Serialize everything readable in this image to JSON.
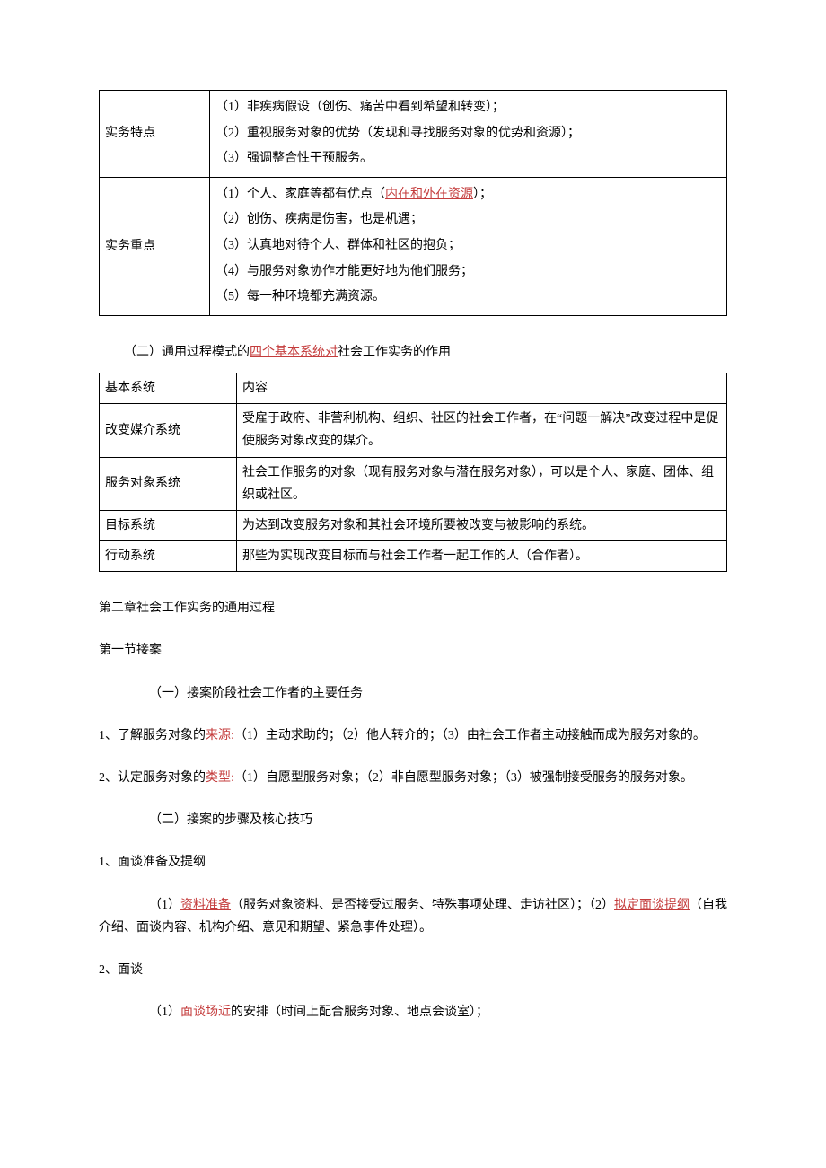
{
  "table1": {
    "row1": {
      "label": "实务特点",
      "lines": [
        "（1）非疾病假设（创伤、痛苦中看到希望和转变）；",
        "（2）重视服务对象的优势（发现和寻找服务对象的优势和资源）；",
        "（3）强调整合性干预服务。"
      ]
    },
    "row2": {
      "label": "实务重点",
      "line1_prefix": "（1）个人、家庭等都有优点（",
      "line1_red": "内在和外在资源",
      "line1_suffix": "）；",
      "lines_rest": [
        "（2）创伤、疾病是伤害，也是机遇；",
        "（3）认真地对待个人、群体和社区的抱负；",
        "（4）与服务对象协作才能更好地为他们服务；",
        "（5）每一种环境都充满资源。"
      ]
    }
  },
  "section1": {
    "pre": "（二）通用过程模式的",
    "red": "四个基本系统对",
    "post": "社会工作实务的作用"
  },
  "table2": {
    "header": {
      "c1": "基本系统",
      "c2": "内容"
    },
    "rows": [
      {
        "c1": "改变媒介系统",
        "c2": "受雇于政府、非营利机构、组织、社区的社会工作者，在“问题一解决”改变过程中是促使服务对象改变的媒介。"
      },
      {
        "c1": "服务对象系统",
        "c2": "社会工作服务的对象（现有服务对象与潜在服务对象），可以是个人、家庭、团体、组织或社区。"
      },
      {
        "c1": "目标系统",
        "c2": "为达到改变服务对象和其社会环境所要被改变与被影响的系统。"
      },
      {
        "c1": "行动系统",
        "c2": "那些为实现改变目标而与社会工作者一起工作的人（合作者）。"
      }
    ]
  },
  "chapter": "第二章社会工作实务的通用过程",
  "node1": "第一节接案",
  "sub1": "（一）接案阶段社会工作者的主要任务",
  "p1": {
    "prefix": "1、了解服务对象的",
    "red": "来源:",
    "rest": "（1）主动求助的；（2）他人转介的；（3）由社会工作者主动接触而成为服务对象的。"
  },
  "p2": {
    "prefix": "2、认定服务对象的",
    "red": "类型:",
    "rest": "（1）自愿型服务对象；（2）非自愿型服务对象；（3）被强制接受服务的服务对象。"
  },
  "sub2": "（二）接案的步骤及核心技巧",
  "p3": "1、面谈准备及提纲",
  "p4": {
    "pre": "（1）",
    "red1": "资料准备",
    "mid": "（服务对象资料、是否接受过服务、特殊事项处理、走访社区）；（2）",
    "red2": "拟定面谈提纲",
    "post": "（自我介绍、面谈内容、机构介绍、意见和期望、紧急事件处理）。"
  },
  "p5": "2、面谈",
  "p6": {
    "pre": "（1）",
    "red": "面谈场近",
    "post": "的安排（时间上配合服务对象、地点会谈室）；"
  }
}
